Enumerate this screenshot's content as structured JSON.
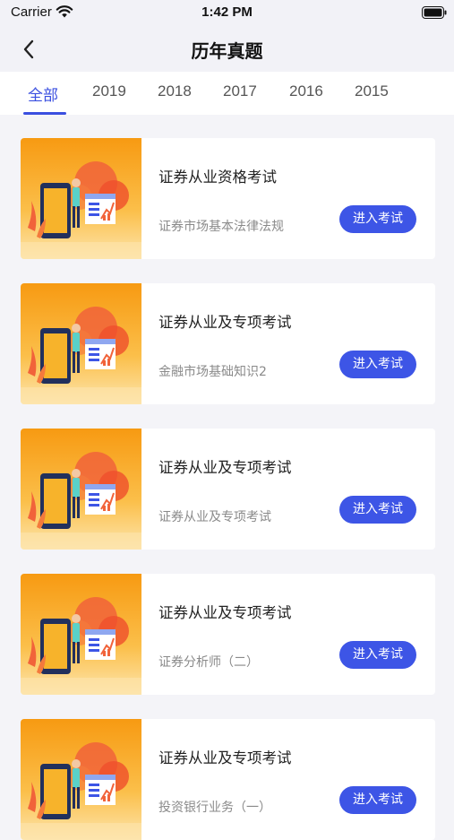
{
  "status_bar": {
    "carrier": "Carrier",
    "time": "1:42 PM",
    "icons": [
      "wifi-icon",
      "battery-icon"
    ]
  },
  "nav": {
    "back_icon": "chevron-left-icon",
    "title": "历年真题"
  },
  "tabs": [
    {
      "label": "全部",
      "active": true
    },
    {
      "label": "2019",
      "active": false
    },
    {
      "label": "2018",
      "active": false
    },
    {
      "label": "2017",
      "active": false
    },
    {
      "label": "2016",
      "active": false
    },
    {
      "label": "2015",
      "active": false
    }
  ],
  "exams": [
    {
      "title": "证券从业资格考试",
      "subtitle": "证券市场基本法律法规",
      "button": "进入考试"
    },
    {
      "title": "证券从业及专项考试",
      "subtitle": "金融市场基础知识2",
      "button": "进入考试"
    },
    {
      "title": "证券从业及专项考试",
      "subtitle": "证券从业及专项考试",
      "button": "进入考试"
    },
    {
      "title": "证券从业及专项考试",
      "subtitle": "证券分析师（二）",
      "button": "进入考试"
    },
    {
      "title": "证券从业及专项考试",
      "subtitle": "投资银行业务（一）",
      "button": "进入考试"
    }
  ],
  "colors": {
    "accent": "#3d55e6",
    "background": "#f4f4f8",
    "thumb_orange": "#f7a21a"
  }
}
